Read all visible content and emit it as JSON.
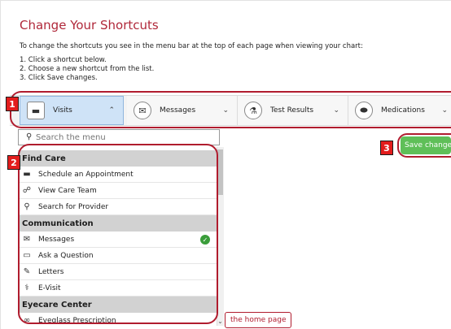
{
  "header": {
    "title": "Change Your Shortcuts",
    "description": "To change the shortcuts you see in the menu bar at the top of each page when viewing your chart:",
    "steps": [
      "1. Click a shortcut below.",
      "2. Choose a new shortcut from the list.",
      "3. Click Save changes."
    ]
  },
  "tabs": [
    {
      "label": "Visits",
      "icon": "calendar-icon",
      "glyph": "▬",
      "chevron": "⌃",
      "active": true
    },
    {
      "label": "Messages",
      "icon": "envelope-icon",
      "glyph": "✉",
      "chevron": "⌄",
      "active": false
    },
    {
      "label": "Test Results",
      "icon": "flask-icon",
      "glyph": "⚗",
      "chevron": "⌄",
      "active": false
    },
    {
      "label": "Medications",
      "icon": "pill-icon",
      "glyph": "⬬",
      "chevron": "⌄",
      "active": false
    }
  ],
  "search": {
    "placeholder": "Search the menu",
    "icon": "search-icon"
  },
  "menu": {
    "categories": [
      {
        "name": "Find Care",
        "items": [
          {
            "label": "Schedule an Appointment",
            "icon": "calendar-icon",
            "glyph": "▬"
          },
          {
            "label": "View Care Team",
            "icon": "care-team-icon",
            "glyph": "☍"
          },
          {
            "label": "Search for Provider",
            "icon": "search-icon",
            "glyph": "⚲"
          }
        ]
      },
      {
        "name": "Communication",
        "items": [
          {
            "label": "Messages",
            "icon": "envelope-icon",
            "glyph": "✉",
            "selected": true
          },
          {
            "label": "Ask a Question",
            "icon": "chat-icon",
            "glyph": "▭"
          },
          {
            "label": "Letters",
            "icon": "letter-icon",
            "glyph": "✎"
          },
          {
            "label": "E-Visit",
            "icon": "stethoscope-icon",
            "glyph": "⚕"
          }
        ]
      },
      {
        "name": "Eyecare Center",
        "items": [
          {
            "label": "Eyeglass Prescription",
            "icon": "glasses-icon",
            "glyph": "∞"
          }
        ]
      }
    ]
  },
  "home_note": {
    "text": "the home page"
  },
  "save": {
    "label": "Save changes",
    "color": "#5fbf58"
  },
  "callouts": [
    "1",
    "2",
    "3"
  ],
  "colors": {
    "accent": "#b0283a",
    "callout_red": "#e31d1d",
    "active_tab": "#cfe3f7",
    "selected_check": "#3a9d3a"
  }
}
